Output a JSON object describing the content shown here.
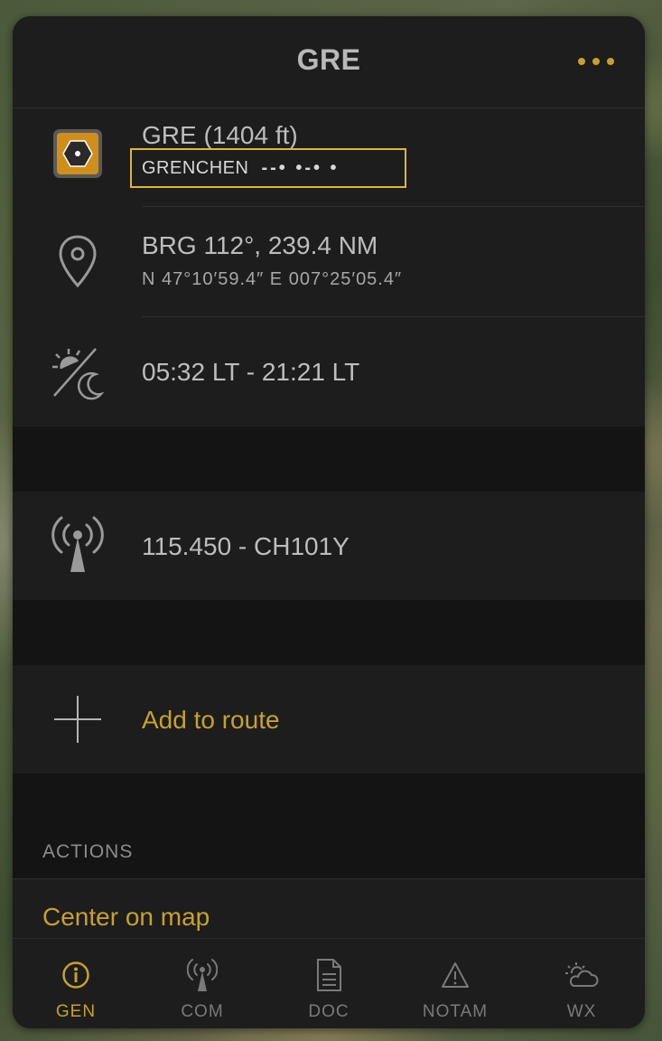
{
  "header": {
    "title": "GRE"
  },
  "info": {
    "name_elevation": "GRE (1404 ft)",
    "ident_name": "GRENCHEN",
    "ident_morse": "--• •-• •",
    "bearing_distance": "BRG 112°, 239.4 NM",
    "coordinates": "N 47°10′59.4″ E 007°25′05.4″",
    "sun_times": "05:32 LT - 21:21 LT",
    "frequency": "115.450 - CH101Y",
    "add_to_route": "Add to route"
  },
  "actions": {
    "section_label": "ACTIONS",
    "center_on_map": "Center on map"
  },
  "tabs": [
    {
      "label": "GEN",
      "icon": "info-icon",
      "active": true
    },
    {
      "label": "COM",
      "icon": "antenna-icon",
      "active": false
    },
    {
      "label": "DOC",
      "icon": "document-icon",
      "active": false
    },
    {
      "label": "NOTAM",
      "icon": "warning-icon",
      "active": false
    },
    {
      "label": "WX",
      "icon": "weather-icon",
      "active": false
    }
  ],
  "colors": {
    "accent": "#c7a12e",
    "highlight": "#e0b53a",
    "panel": "#1d1d1d"
  }
}
